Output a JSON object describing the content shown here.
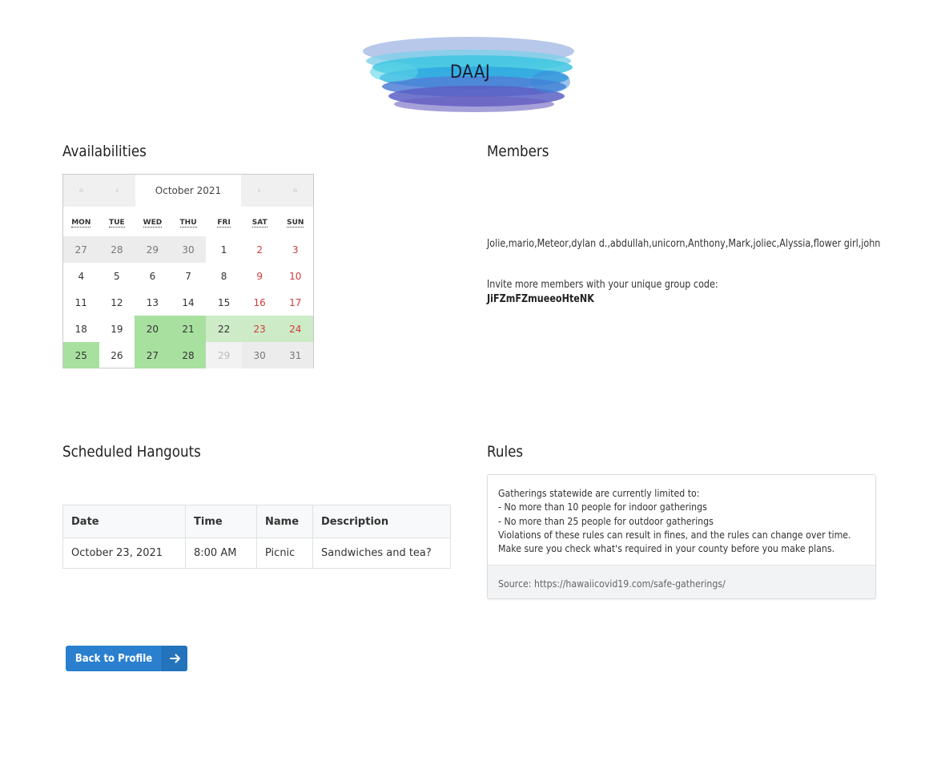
{
  "banner": {
    "title": "DAAJ"
  },
  "availabilities": {
    "title": "Availabilities",
    "calendar": {
      "month_label": "October 2021",
      "nav": {
        "prev_year": "«",
        "prev_month": "‹",
        "next_month": "›",
        "next_year": "»"
      },
      "dows": [
        "MON",
        "TUE",
        "WED",
        "THU",
        "FRI",
        "SAT",
        "SUN"
      ],
      "weeks": [
        [
          {
            "d": "27",
            "t": "other"
          },
          {
            "d": "28",
            "t": "other"
          },
          {
            "d": "29",
            "t": "other"
          },
          {
            "d": "30",
            "t": "other"
          },
          {
            "d": "1",
            "t": ""
          },
          {
            "d": "2",
            "t": "weekend"
          },
          {
            "d": "3",
            "t": "weekend"
          }
        ],
        [
          {
            "d": "4",
            "t": ""
          },
          {
            "d": "5",
            "t": ""
          },
          {
            "d": "6",
            "t": ""
          },
          {
            "d": "7",
            "t": ""
          },
          {
            "d": "8",
            "t": ""
          },
          {
            "d": "9",
            "t": "weekend"
          },
          {
            "d": "10",
            "t": "weekend"
          }
        ],
        [
          {
            "d": "11",
            "t": ""
          },
          {
            "d": "12",
            "t": ""
          },
          {
            "d": "13",
            "t": ""
          },
          {
            "d": "14",
            "t": ""
          },
          {
            "d": "15",
            "t": ""
          },
          {
            "d": "16",
            "t": "weekend"
          },
          {
            "d": "17",
            "t": "weekend"
          }
        ],
        [
          {
            "d": "18",
            "t": ""
          },
          {
            "d": "19",
            "t": ""
          },
          {
            "d": "20",
            "t": "avail"
          },
          {
            "d": "21",
            "t": "avail"
          },
          {
            "d": "22",
            "t": "avail-weekend"
          },
          {
            "d": "23",
            "t": "weekend avail-weekend"
          },
          {
            "d": "24",
            "t": "weekend avail-weekend"
          }
        ],
        [
          {
            "d": "25",
            "t": "avail"
          },
          {
            "d": "26",
            "t": ""
          },
          {
            "d": "27",
            "t": "avail"
          },
          {
            "d": "28",
            "t": "avail"
          },
          {
            "d": "29",
            "t": "dim"
          },
          {
            "d": "30",
            "t": "weekend other"
          },
          {
            "d": "31",
            "t": "weekend other"
          }
        ]
      ]
    }
  },
  "members": {
    "title": "Members",
    "list": "Jolie,mario,Meteor,dylan d.,abdullah,unicorn,Anthony,Mark,joliec,Alyssia,flower girl,john",
    "invite_text": "Invite more members with your unique group code:",
    "group_code": "JiFZmFZmueeoHteNK"
  },
  "hangouts": {
    "title": "Scheduled Hangouts",
    "columns": [
      "Date",
      "Time",
      "Name",
      "Description"
    ],
    "rows": [
      [
        "October 23, 2021",
        "8:00 AM",
        "Picnic",
        "Sandwiches and tea?"
      ]
    ]
  },
  "rules": {
    "title": "Rules",
    "lines": [
      "Gatherings statewide are currently limited to:",
      "- No more than 10 people for indoor gatherings",
      "- No more than 25 people for outdoor gatherings",
      "Violations of these rules can result in fines, and the rules can change over time.",
      "Make sure you check what's required in your county before you make plans."
    ],
    "source": "Source: https://hawaiicovid19.com/safe-gatherings/"
  },
  "back_button": {
    "label": "Back to Profile"
  },
  "colors": {
    "accent": "#2a7fce",
    "available": "#a8e0a0",
    "weekend_text": "#d13b3b"
  }
}
